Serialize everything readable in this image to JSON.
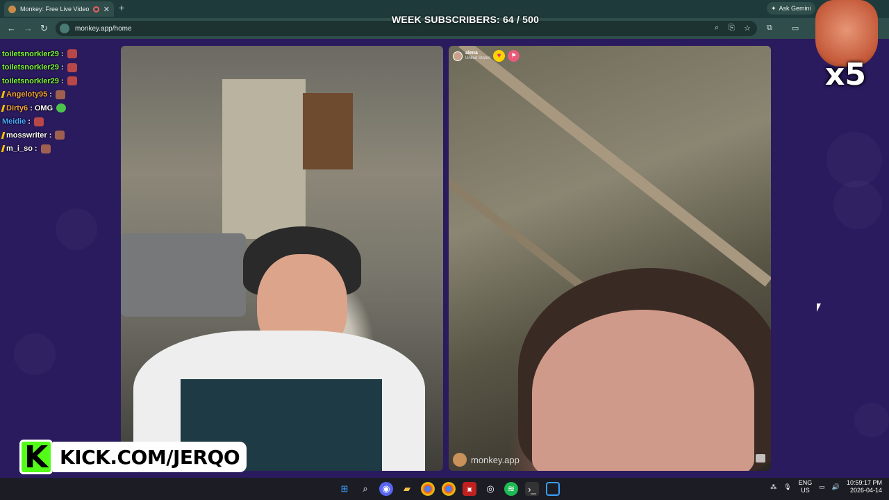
{
  "browser": {
    "tab_title": "Monkey: Free Live Video Ch",
    "new_tab_symbol": "+",
    "ask_gemini": "Ask Gemini",
    "url": "monkey.app/home"
  },
  "overlay": {
    "subscribers_label": "WEEK SUBSCRIBERS: 64 / 500",
    "meme_multiplier": "x5",
    "kick_k": "K",
    "kick_url": "KICK.COM/JERQO"
  },
  "chat": {
    "messages": [
      {
        "user": "toiletsnorkler29",
        "text": "",
        "color": "#7cfc3a"
      },
      {
        "user": "toiletsnorkler29",
        "text": "",
        "color": "#7cfc3a"
      },
      {
        "user": "toiletsnorkler29",
        "text": "",
        "color": "#7cfc3a"
      },
      {
        "user": "Angeloty95",
        "text": "",
        "color": "#f2a23a"
      },
      {
        "user": "Dirty6",
        "text": "OMG",
        "color": "#f2a23a"
      },
      {
        "user": "Meidie",
        "text": "",
        "color": "#4aa8ff"
      },
      {
        "user": "mosswriter",
        "text": "",
        "color": "#ffffff"
      },
      {
        "user": "m_i_so",
        "text": "",
        "color": "#ffffff"
      }
    ]
  },
  "call": {
    "peer_name": "alena",
    "peer_country": "United States",
    "watermark": "monkey.app"
  },
  "taskbar": {
    "lang_1": "ENG",
    "lang_2": "US",
    "time": "10:59:17 PM",
    "date": "2026-04-14"
  },
  "colors": {
    "page_bg": "#2a1a5e",
    "kick_green": "#53fc18",
    "browser_chrome": "#2f4d4a"
  }
}
